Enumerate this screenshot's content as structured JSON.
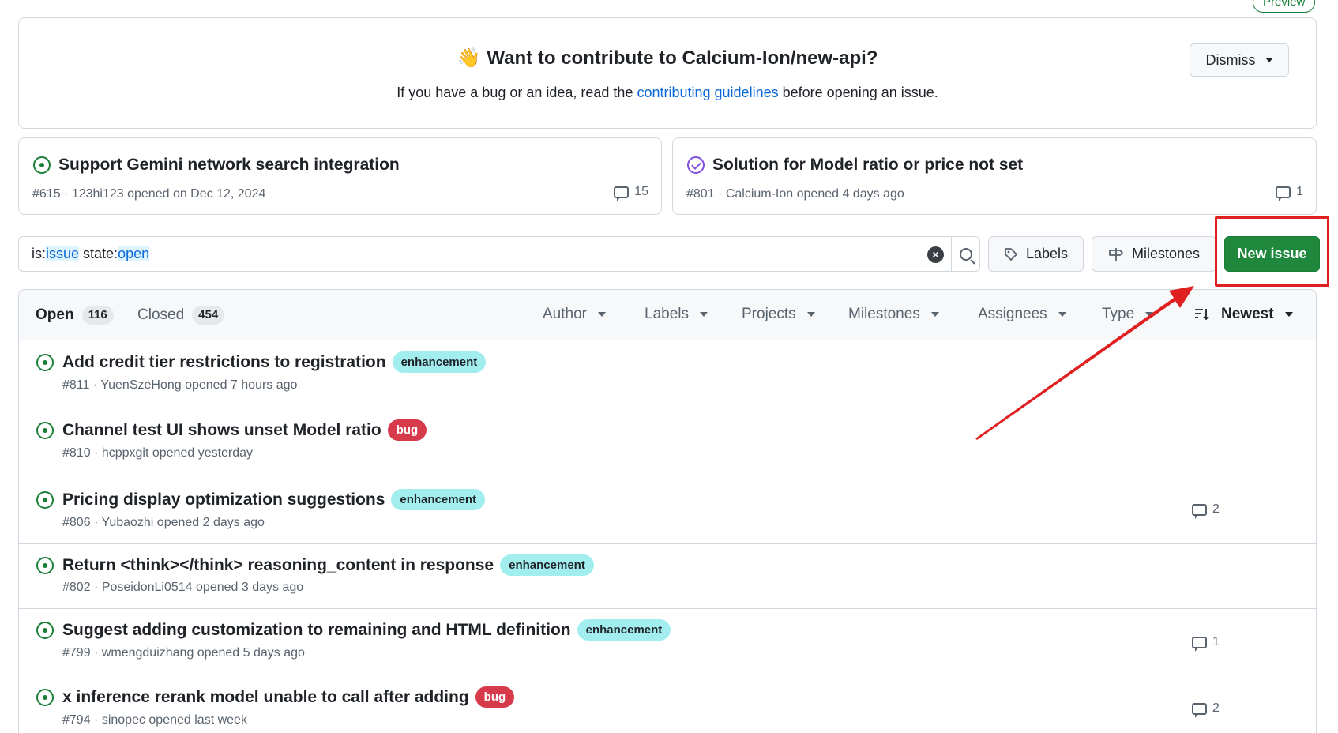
{
  "preview_badge": "Preview",
  "banner": {
    "title": "Want to contribute to Calcium-Ion/new-api?",
    "text_before": "If you have a bug or an idea, read the",
    "link": "contributing guidelines",
    "text_after": "before opening an issue.",
    "dismiss_label": "Dismiss"
  },
  "pinned": [
    {
      "title": "Support Gemini network search integration",
      "meta": "#615 · 123hi123 opened on Dec 12, 2024",
      "comments": "15",
      "icon": "issue-open-icon"
    },
    {
      "title": "Solution for Model ratio or price not set",
      "meta": "#801 · Calcium-Ion opened 4 days ago",
      "comments": "1",
      "icon": "issue-closed-icon"
    }
  ],
  "search": {
    "prefix_1": "is:",
    "token_1": "issue",
    "prefix_2": " state:",
    "token_2": "open"
  },
  "toolbar": {
    "labels_label": "Labels",
    "milestones_label": "Milestones",
    "new_issue_label": "New issue"
  },
  "list_header": {
    "open_label": "Open",
    "open_count": "116",
    "closed_label": "Closed",
    "closed_count": "454",
    "filters": [
      "Author",
      "Labels",
      "Projects",
      "Milestones",
      "Assignees",
      "Type"
    ],
    "sort_label": "Newest"
  },
  "issues": [
    {
      "title": "Add credit tier restrictions to registration",
      "label": "enhancement",
      "meta": "#811 · YuenSzeHong opened 7 hours ago",
      "comments": ""
    },
    {
      "title": "Channel test UI shows unset Model ratio",
      "label": "bug",
      "meta": "#810 · hcppxgit opened yesterday",
      "comments": ""
    },
    {
      "title": "Pricing display optimization suggestions",
      "label": "enhancement",
      "meta": "#806 · Yubaozhi opened 2 days ago",
      "comments": "2"
    },
    {
      "title": "Return <think></think> reasoning_content in response",
      "label": "enhancement",
      "meta": "#802 · PoseidonLi0514 opened 3 days ago",
      "comments": ""
    },
    {
      "title": "Suggest adding customization to remaining and HTML definition",
      "label": "enhancement",
      "meta": "#799 · wmengduizhang opened 5 days ago",
      "comments": "1"
    },
    {
      "title": "x inference rerank model unable to call after adding",
      "label": "bug",
      "meta": "#794 · sinopec opened last week",
      "comments": "2"
    }
  ],
  "colors": {
    "accent_green": "#1f883d",
    "link_blue": "#0969da",
    "annotation_red": "#e02020",
    "enhancement_bg": "#a2eeef",
    "bug_bg": "#d73a4a"
  }
}
